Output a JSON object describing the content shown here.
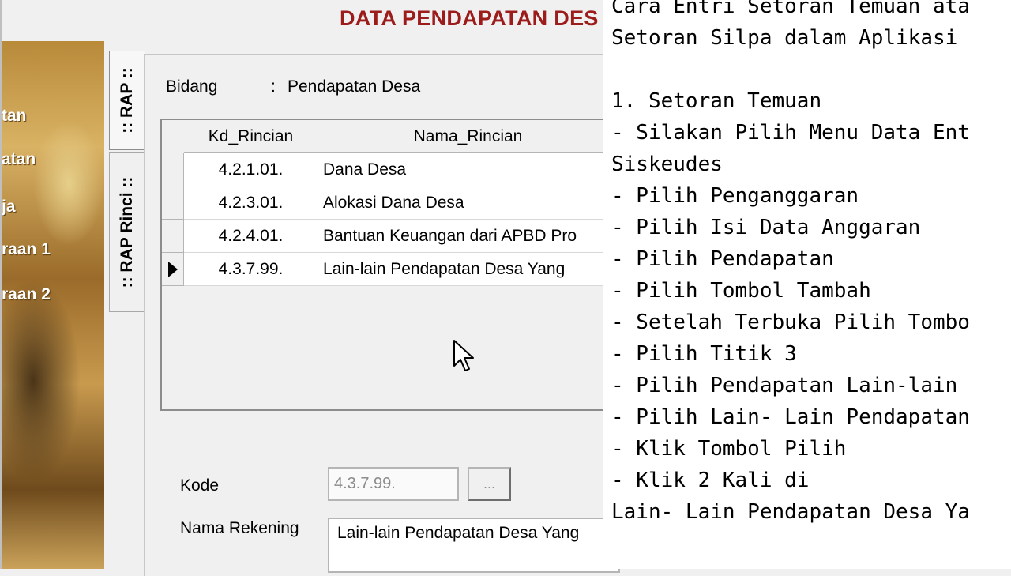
{
  "window": {
    "title": "DATA PENDAPATAN DES"
  },
  "sidebar": {
    "items": [
      "tan",
      "atan",
      "ja",
      "raan 1",
      "raan 2"
    ]
  },
  "tabs": [
    {
      "label": ":: RAP ::"
    },
    {
      "label": ":: RAP Rinci ::"
    }
  ],
  "form": {
    "bidang_label": "Bidang",
    "bidang_colon": ":",
    "bidang_value": "Pendapatan Desa",
    "kode_label": "Kode",
    "kode_value": "4.3.7.99.",
    "kode_button": "...",
    "nama_rekening_label": "Nama Rekening",
    "nama_rekening_value": "Lain-lain Pendapatan Desa Yang"
  },
  "grid": {
    "columns": [
      "Kd_Rincian",
      "Nama_Rincian"
    ],
    "rows": [
      {
        "kd": "4.2.1.01.",
        "nama": "Dana Desa"
      },
      {
        "kd": "4.2.3.01.",
        "nama": "Alokasi Dana Desa"
      },
      {
        "kd": "4.2.4.01.",
        "nama": "Bantuan Keuangan dari APBD Pro"
      },
      {
        "kd": "4.3.7.99.",
        "nama": "Lain-lain Pendapatan Desa Yang"
      }
    ],
    "selected_row": 3
  },
  "notes": {
    "lines": [
      "Cara Entri Setoran Temuan ata",
      "Setoran Silpa dalam Aplikasi",
      "",
      "1. Setoran Temuan",
      "- Silakan Pilih Menu Data Ent",
      "Siskeudes",
      "- Pilih Penganggaran",
      "- Pilih Isi Data Anggaran",
      "- Pilih Pendapatan",
      "- Pilih Tombol Tambah",
      "- Setelah Terbuka Pilih Tombo",
      "- Pilih Titik 3",
      "- Pilih Pendapatan Lain-lain",
      "- Pilih Lain- Lain Pendapatan",
      "- Klik Tombol Pilih",
      "- Klik 2 Kali di",
      "Lain- Lain Pendapatan Desa Ya"
    ]
  },
  "colors": {
    "title": "#9c1b1b",
    "panel": "#f0f0f0"
  },
  "icons": {
    "cursor": "mouse-pointer-icon",
    "row_indicator": "row-pointer-icon"
  }
}
